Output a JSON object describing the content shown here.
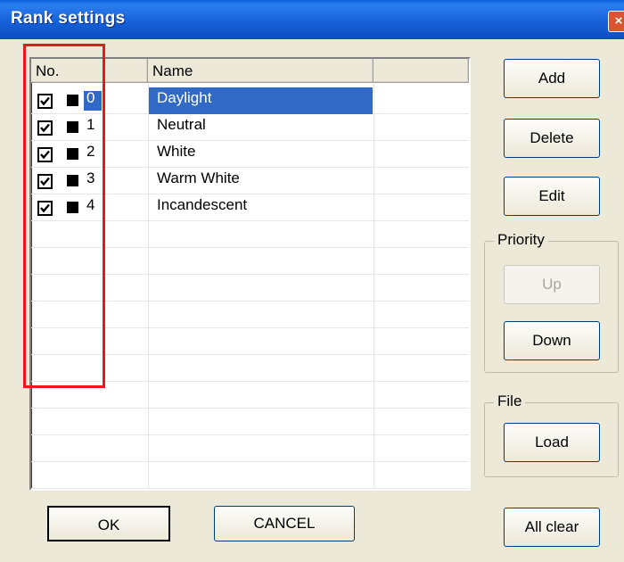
{
  "window": {
    "title": "Rank settings",
    "close_glyph": "×"
  },
  "list": {
    "columns": [
      "No.",
      "Name"
    ],
    "rows": [
      {
        "no": "0",
        "name": "Daylight",
        "checked": true,
        "selected": true
      },
      {
        "no": "1",
        "name": "Neutral",
        "checked": true,
        "selected": false
      },
      {
        "no": "2",
        "name": "White",
        "checked": true,
        "selected": false
      },
      {
        "no": "3",
        "name": "Warm White",
        "checked": true,
        "selected": false
      },
      {
        "no": "4",
        "name": "Incandescent",
        "checked": true,
        "selected": false
      }
    ]
  },
  "buttons": {
    "add": "Add",
    "delete": "Delete",
    "edit": "Edit",
    "up": "Up",
    "down": "Down",
    "load": "Load",
    "ok": "OK",
    "cancel": "CANCEL",
    "all_clear": "All clear"
  },
  "groups": {
    "priority": "Priority",
    "file": "File"
  },
  "colors": {
    "selection": "#3169c6",
    "highlight_box": "#e31b1b",
    "titlebar": "#0b5ad4"
  }
}
